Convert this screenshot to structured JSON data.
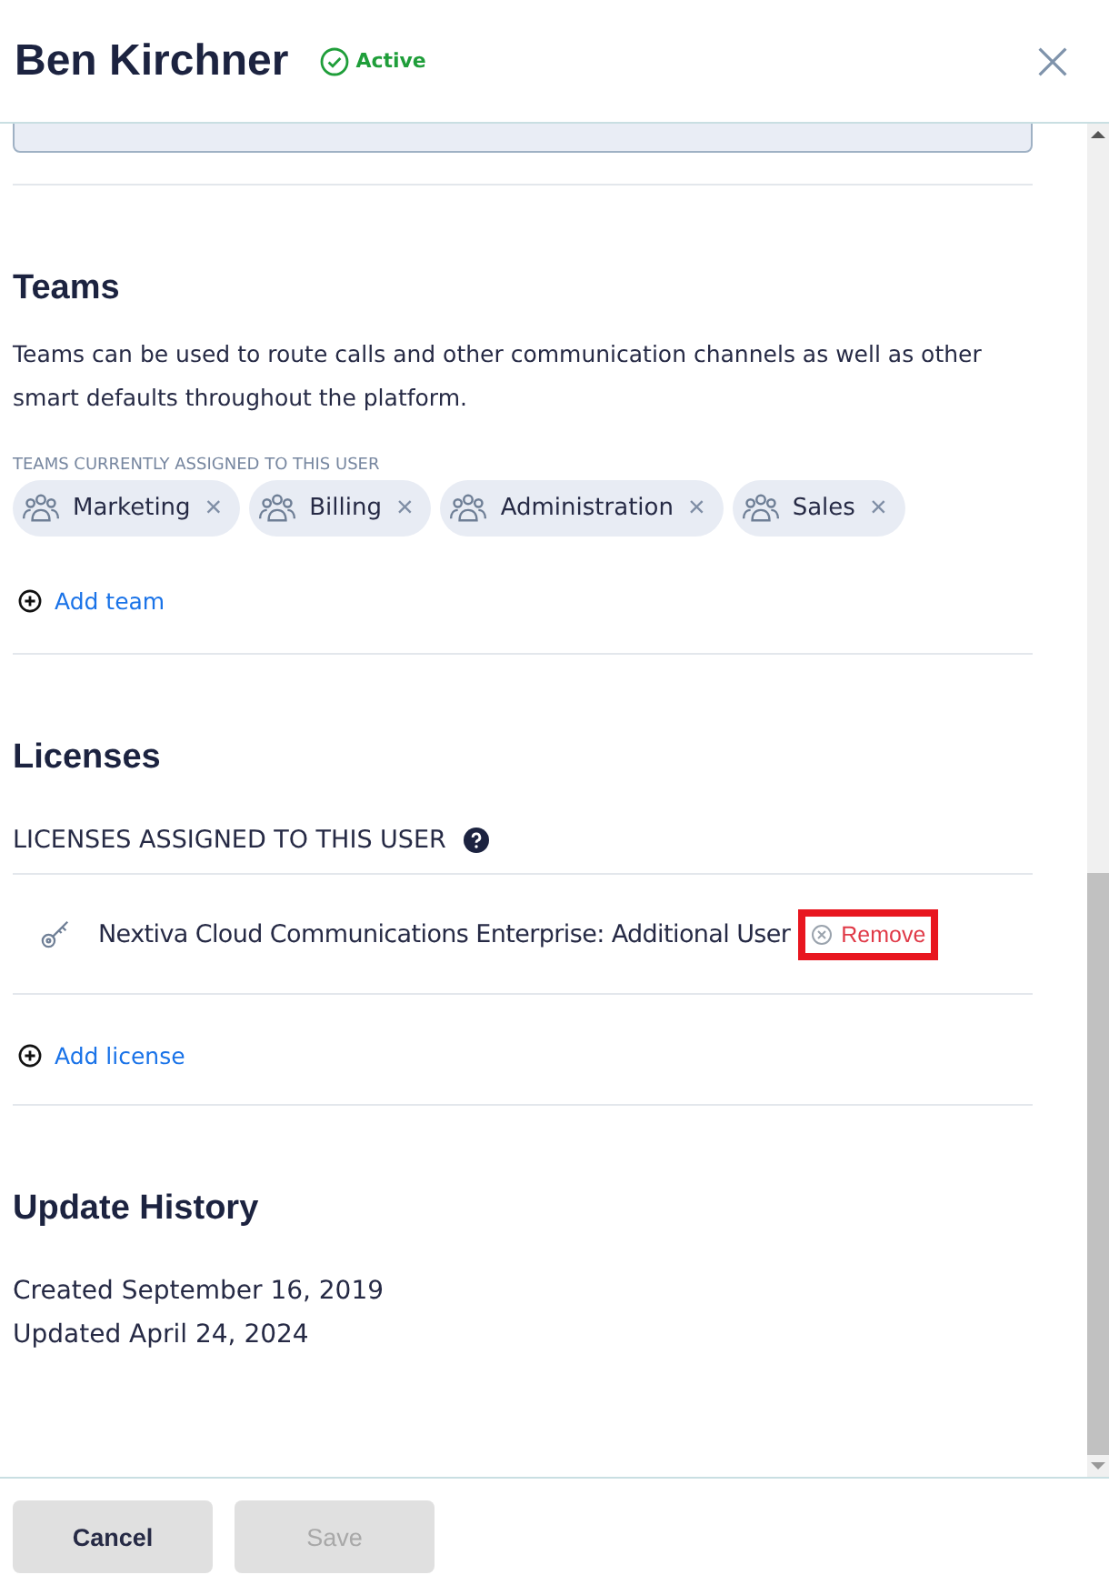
{
  "header": {
    "title": "Ben Kirchner",
    "status": "Active"
  },
  "teams": {
    "title": "Teams",
    "description": "Teams can be used to route calls and other communication channels as well as other smart defaults throughout the platform.",
    "list_label": "TEAMS CURRENTLY ASSIGNED TO THIS USER",
    "items": [
      {
        "name": "Marketing",
        "remove": "×"
      },
      {
        "name": "Billing",
        "remove": "×"
      },
      {
        "name": "Administration",
        "remove": "×"
      },
      {
        "name": "Sales",
        "remove": "×"
      }
    ],
    "add": "Add team"
  },
  "licenses": {
    "title": "Licenses",
    "list_label": "LICENSES ASSIGNED TO THIS USER",
    "items": [
      {
        "name": "Nextiva Cloud Communications Enterprise: Additional User",
        "action": "Remove",
        "highlighted": true
      }
    ],
    "add": "Add license"
  },
  "history": {
    "title": "Update History",
    "lines": [
      "Created September 16, 2019",
      "Updated April 24, 2024"
    ]
  },
  "buttons": [
    {
      "label": "Cancel",
      "disabled": false
    },
    {
      "label": "Save",
      "disabled": true
    }
  ]
}
